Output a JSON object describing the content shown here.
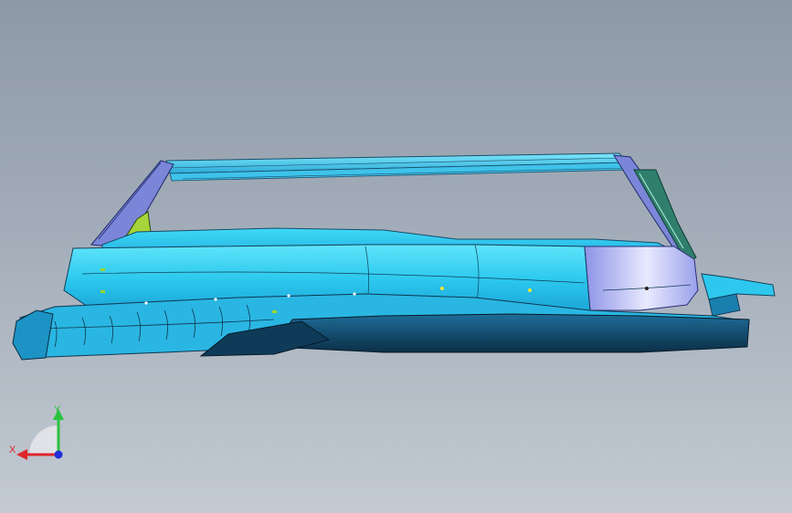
{
  "viewer": {
    "background_top": "#8e99a7",
    "background_bottom": "#c3cad2"
  },
  "model": {
    "primary_color": "#2fd4f2",
    "shade_color": "#1597c8",
    "dark_color": "#0d3a56",
    "highlight_color": "#b7b9f0",
    "accent_color": "#9fd52a"
  },
  "triad": {
    "x_label": "X",
    "y_label": "Y",
    "x_color": "#e0262b",
    "y_color": "#2ac23d",
    "z_color": "#1e2fd8"
  }
}
